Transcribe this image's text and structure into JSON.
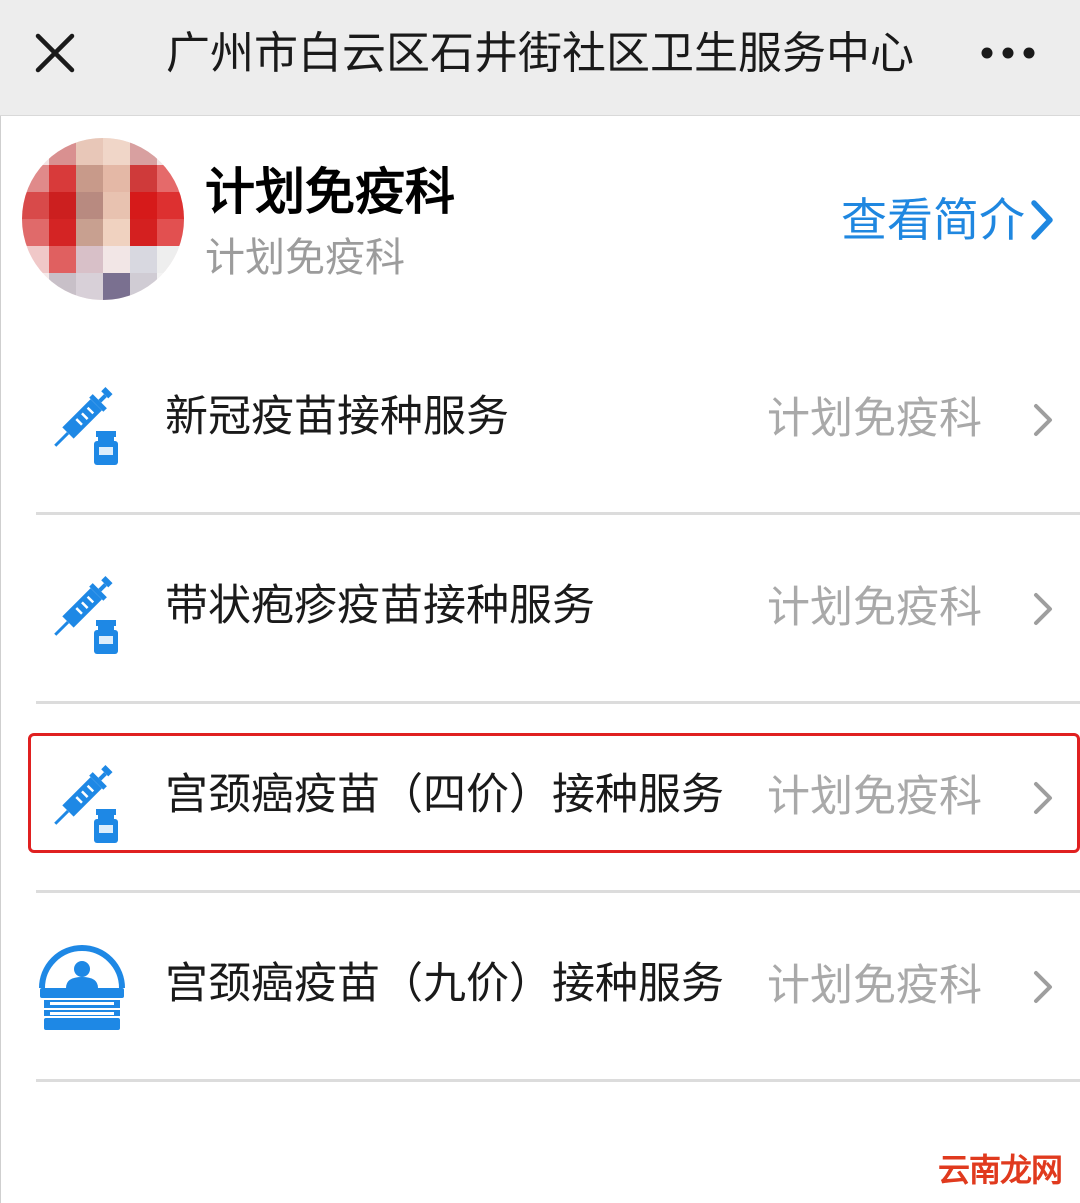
{
  "navbar": {
    "close_icon": "close-icon",
    "title": "广州市白云区石井街社区卫生服务中心",
    "more_icon": "more-icon"
  },
  "header": {
    "avatar_icon": "department-avatar",
    "title": "计划免疫科",
    "subtitle": "计划免疫科",
    "view_intro_label": "查看简介",
    "view_intro_icon": "chevron-right-icon",
    "accent_color": "#1f87e0"
  },
  "services": [
    {
      "title": "新冠疫苗接种服务",
      "department": "计划免疫科",
      "icon": "syringe-vial-icon"
    },
    {
      "title": "带状疱疹疫苗接种服务",
      "department": "计划免疫科",
      "icon": "syringe-vial-icon"
    },
    {
      "title": "宫颈癌疫苗（四价）接种服务",
      "department": "计划免疫科",
      "icon": "syringe-vial-icon",
      "highlighted": true
    },
    {
      "title": "宫颈癌疫苗（九价）接种服务",
      "department": "计划免疫科",
      "icon": "service-desk-icon"
    }
  ],
  "highlight_color": "#e02020",
  "watermark": "云南龙网"
}
